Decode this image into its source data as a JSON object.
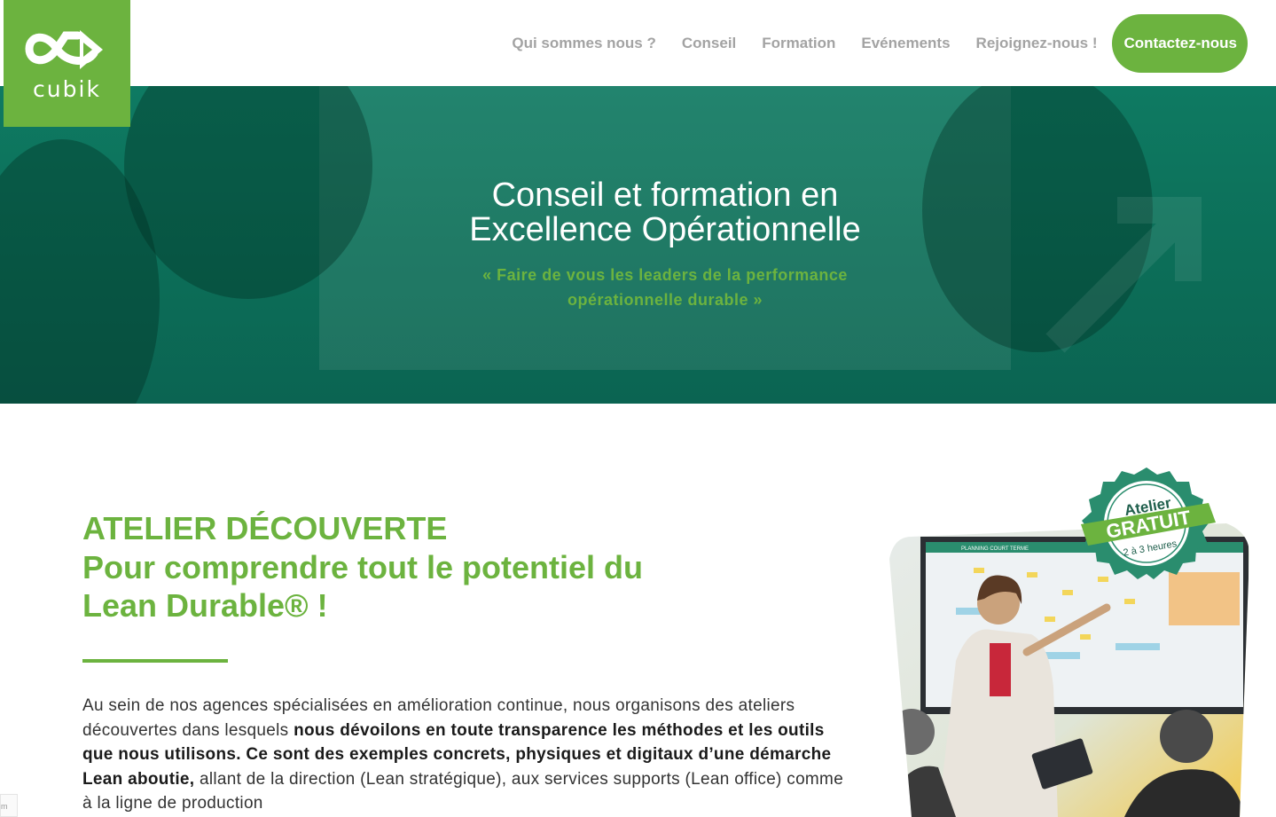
{
  "brand": {
    "name": "cubik",
    "color": "#6cb33f"
  },
  "nav": {
    "items": [
      "Qui sommes nous ?",
      "Conseil",
      "Formation",
      "Evénements",
      "Rejoignez-nous !"
    ],
    "cta": "Contactez-nous"
  },
  "hero": {
    "title_line1": "Conseil et formation en",
    "title_line2": "Excellence Opérationnelle",
    "subtitle_line1": "« Faire de vous les leaders de la performance",
    "subtitle_line2": "opérationnelle durable »"
  },
  "section": {
    "kicker": "ATELIER DÉCOUVERTE",
    "headline_line1": "Pour comprendre tout le potentiel du",
    "headline_line2": "Lean Durable® !",
    "p_1": "Au sein de nos agences spécialisées en amélioration continue, nous organisons des ateliers découvertes dans lesquels ",
    "p_2": "nous dévoilons en toute transparence les méthodes et les outils que nous utilisons. Ce sont des exemples concrets, physiques et digitaux d’une démarche Lean aboutie,",
    "p_3": " allant de la direction (Lean stratégique), aux services supports (Lean office) comme à la ligne de production"
  },
  "badge": {
    "top": "Atelier",
    "main": "GRATUIT",
    "bottom": "2 à 3 heures"
  },
  "screen": {
    "title": "PLANNING COURT TERME"
  },
  "corner_tag": "m"
}
